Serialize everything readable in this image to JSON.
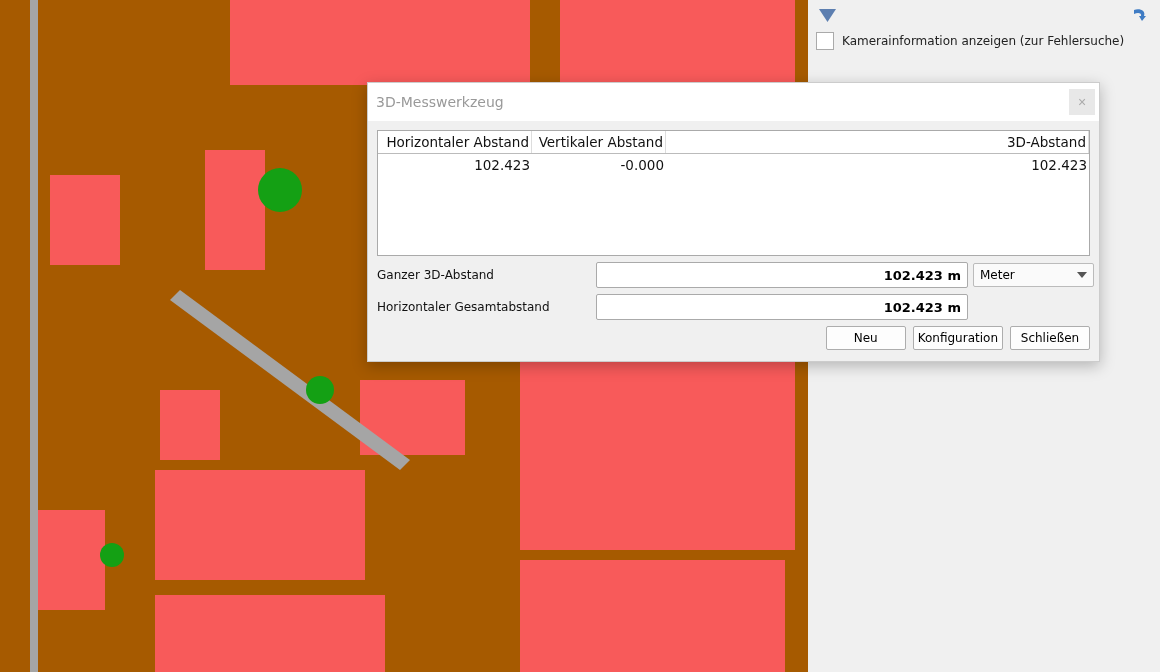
{
  "side_panel": {
    "checkbox": {
      "label": "Kamerainformation anzeigen (zur Fehlersuche)",
      "checked": false
    }
  },
  "dialog": {
    "title": "3D-Messwerkzeug",
    "close": "×",
    "table": {
      "columns": [
        "Horizontaler Abstand",
        "Vertikaler Abstand",
        "3D-Abstand"
      ],
      "rows": [
        [
          "102.423",
          "-0.000",
          "102.423"
        ]
      ]
    },
    "fields": [
      {
        "label": "Ganzer 3D-Abstand",
        "value": "102.423 m",
        "unit": "Meter"
      },
      {
        "label": "Horizontaler Gesamtabstand",
        "value": "102.423 m"
      }
    ],
    "buttons": [
      "Neu",
      "Konfiguration",
      "Schließen"
    ]
  }
}
